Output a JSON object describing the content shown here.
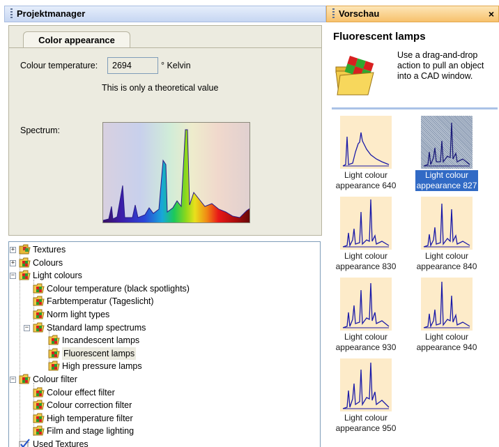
{
  "projektmanager": {
    "title": "Projektmanager",
    "tab_label": "Color appearance",
    "colour_temperature_label": "Colour temperature:",
    "colour_temperature_value": "2694",
    "unit": "° Kelvin",
    "note": "This is only a theoretical value",
    "spectrum_label": "Spectrum:"
  },
  "tree": {
    "items": [
      {
        "label": "Textures"
      },
      {
        "label": "Colours"
      },
      {
        "label": "Light colours"
      },
      {
        "label": "Colour temperature (black spotlights)"
      },
      {
        "label": "Farbtemperatur (Tageslicht)"
      },
      {
        "label": "Norm light types"
      },
      {
        "label": "Standard lamp spectrums"
      },
      {
        "label": "Incandescent lamps"
      },
      {
        "label": "Fluorescent lamps"
      },
      {
        "label": "High pressure lamps"
      },
      {
        "label": "Colour filter"
      },
      {
        "label": "Colour effect filter"
      },
      {
        "label": "Colour correction filter"
      },
      {
        "label": "High temperature filter"
      },
      {
        "label": "Film and stage lighting"
      },
      {
        "label": "Used Textures"
      }
    ]
  },
  "vorschau": {
    "title": "Vorschau",
    "close_glyph": "×",
    "heading": "Fluorescent lamps",
    "hint": "Use a drag-and-drop action to pull an object into a CAD window.",
    "tiles": [
      {
        "line1": "Light colour",
        "line2": "appearance 640"
      },
      {
        "line1": "Light colour",
        "line2": "appearance 827"
      },
      {
        "line1": "Light colour",
        "line2": "appearance 830"
      },
      {
        "line1": "Light colour",
        "line2": "appearance 840"
      },
      {
        "line1": "Light colour",
        "line2": "appearance 930"
      },
      {
        "line1": "Light colour",
        "line2": "appearance 940"
      },
      {
        "line1": "Light colour",
        "line2": "appearance 950"
      }
    ]
  },
  "colors": {
    "header_blue": "#c6d6f2",
    "header_orange": "#f7c16c",
    "selection": "#316ac5",
    "thumb_bg": "#fdebc9",
    "spectrum_line": "#1a1aa8"
  }
}
